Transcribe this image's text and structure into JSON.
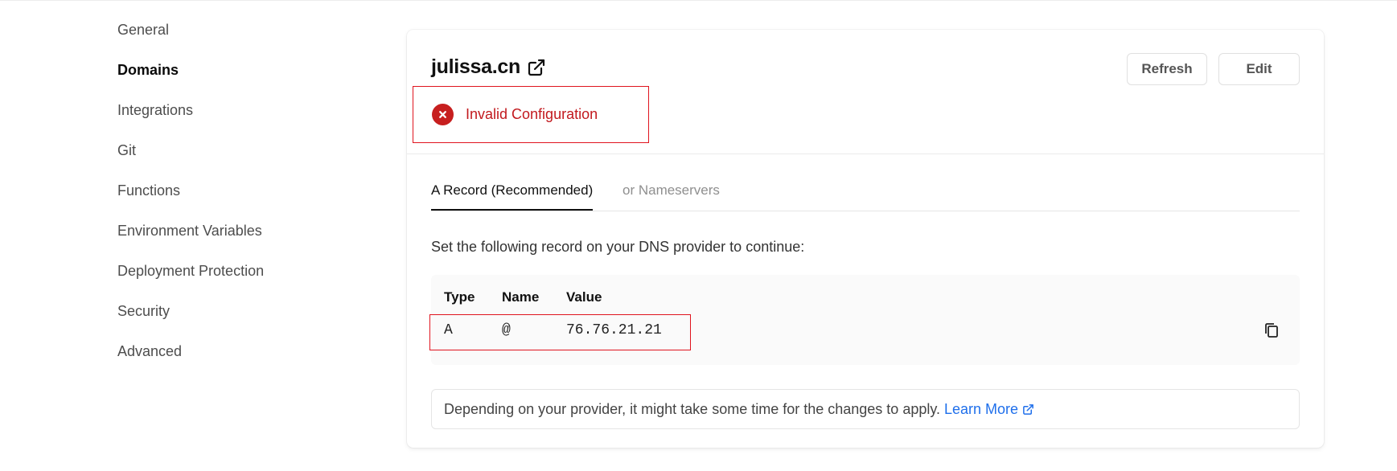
{
  "sidebar": {
    "items": [
      {
        "label": "General"
      },
      {
        "label": "Domains",
        "active": true
      },
      {
        "label": "Integrations"
      },
      {
        "label": "Git"
      },
      {
        "label": "Functions"
      },
      {
        "label": "Environment Variables"
      },
      {
        "label": "Deployment Protection"
      },
      {
        "label": "Security"
      },
      {
        "label": "Advanced"
      }
    ]
  },
  "domain": {
    "name": "julissa.cn",
    "status": "Invalid Configuration",
    "status_color": "#c2191e"
  },
  "buttons": {
    "refresh": "Refresh",
    "edit": "Edit"
  },
  "tabs": [
    {
      "label": "A Record (Recommended)",
      "active": true
    },
    {
      "label": "or Nameservers",
      "active": false
    }
  ],
  "instructions": "Set the following record on your DNS provider to continue:",
  "record_table": {
    "headers": [
      "Type",
      "Name",
      "Value"
    ],
    "row": [
      "A",
      "@",
      "76.76.21.21"
    ]
  },
  "note": {
    "text": "Depending on your provider, it might take some time for the changes to apply.",
    "link": "Learn More",
    "link_color": "#1f6feb"
  },
  "icons": [
    "external-link-icon",
    "error-x-icon",
    "copy-icon"
  ]
}
